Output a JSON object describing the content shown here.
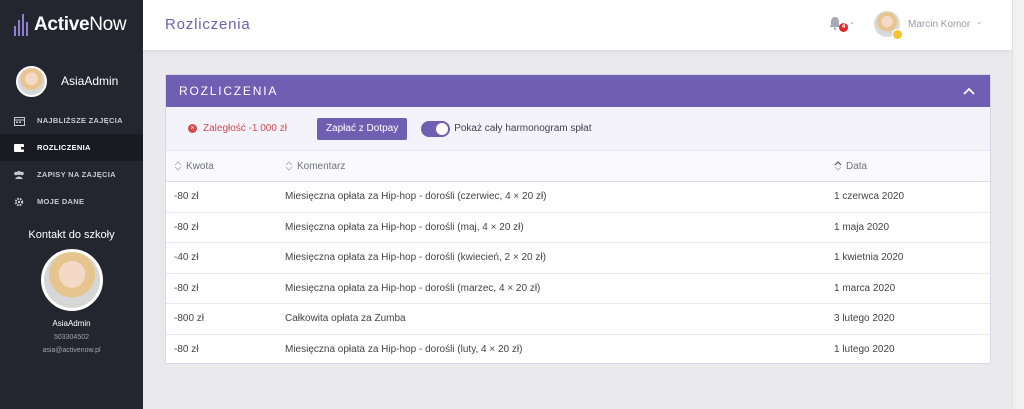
{
  "app": {
    "logo_main": "Active",
    "logo_accent": "Now"
  },
  "sidebar": {
    "user_name": "AsiaAdmin",
    "menu": [
      {
        "label": "NAJBLIŻSZE ZAJĘCIA",
        "icon": "calendar-icon"
      },
      {
        "label": "ROZLICZENIA",
        "icon": "wallet-icon"
      },
      {
        "label": "ZAPISY NA ZAJĘCIA",
        "icon": "users-icon"
      },
      {
        "label": "MOJE DANE",
        "icon": "gear-icon"
      }
    ],
    "contact": {
      "title": "Kontakt do szkoły",
      "name": "AsiaAdmin",
      "phone": "503304502",
      "email": "asia@activenow.pl"
    }
  },
  "header": {
    "title": "Rozliczenia",
    "notifications_count": "4",
    "user_name": "Marcin Komor"
  },
  "panel": {
    "title": "ROZLICZENIA",
    "debt_label": "Zaległość -1 000 zł",
    "pay_button": "Zapłać z Dotpay",
    "toggle_label": "Pokaż cały harmonogram spłat",
    "toggle_on": true
  },
  "table": {
    "columns": [
      "Kwota",
      "Komentarz",
      "Data"
    ],
    "rows": [
      {
        "amount": "-80 zł",
        "comment": "Miesięczna opłata za Hip-hop - dorośli (czerwiec, 4 × 20 zł)",
        "date": "1 czerwca 2020"
      },
      {
        "amount": "-80 zł",
        "comment": "Miesięczna opłata za Hip-hop - dorośli (maj, 4 × 20 zł)",
        "date": "1 maja 2020"
      },
      {
        "amount": "-40 zł",
        "comment": "Miesięczna opłata za Hip-hop - dorośli (kwiecień, 2 × 20 zł)",
        "date": "1 kwietnia 2020"
      },
      {
        "amount": "-80 zł",
        "comment": "Miesięczna opłata za Hip-hop - dorośli (marzec, 4 × 20 zł)",
        "date": "1 marca 2020"
      },
      {
        "amount": "-800 zł",
        "comment": "Całkowita opłata za Zumba",
        "date": "3 lutego 2020"
      },
      {
        "amount": "-80 zł",
        "comment": "Miesięczna opłata za Hip-hop - dorośli (luty, 4 × 20 zł)",
        "date": "1 lutego 2020"
      }
    ]
  },
  "colors": {
    "accent": "#6f5fb3",
    "sidebar": "#23252f",
    "danger": "#d24c4c"
  }
}
